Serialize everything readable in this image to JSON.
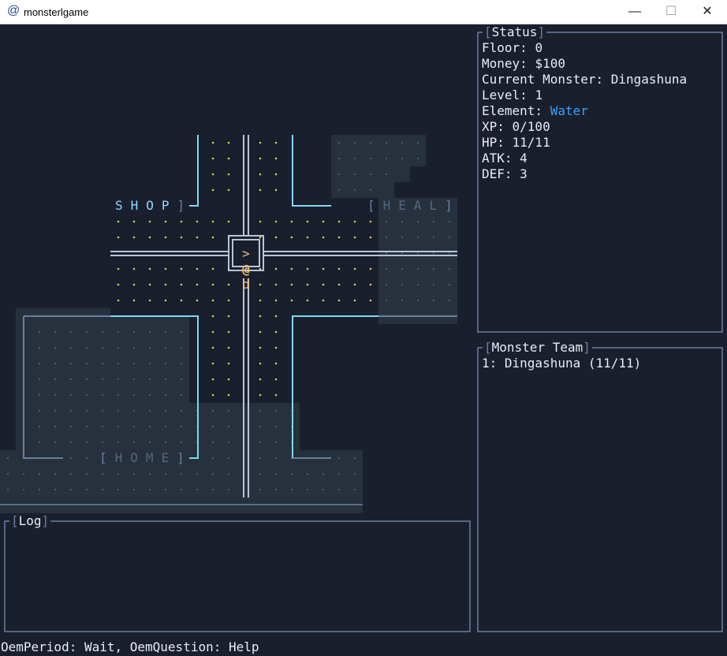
{
  "window": {
    "title": "monsterlgame",
    "app_icon": "@",
    "minimize": "—",
    "maximize": "☐",
    "close": "✕"
  },
  "map": {
    "shop_label": "SHOP",
    "heal_label": "HEAL",
    "home_label": "HOME",
    "stairs_glyph": ">",
    "player_glyph": "@",
    "companion_glyph": "d"
  },
  "status": {
    "title": "Status",
    "floor_label": "Floor: ",
    "floor": "0",
    "money_label": "Money: ",
    "money": "$100",
    "monster_label": "Current Monster: ",
    "monster": "Dingashuna",
    "level_label": "Level: ",
    "level": "1",
    "element_label": "Element: ",
    "element": "Water",
    "xp_label": "XP: ",
    "xp": "0/100",
    "hp_label": "HP: ",
    "hp": "11/11",
    "atk_label": "ATK: ",
    "atk": "4",
    "def_label": "DEF: ",
    "def": "3"
  },
  "team": {
    "title": "Monster Team",
    "members": [
      "1: Dingashuna (11/11)"
    ]
  },
  "log": {
    "title": "Log"
  },
  "hint": "OemPeriod: Wait, OemQuestion: Help",
  "colors": {
    "background": "#1a1f2e",
    "border": "#6b7fa0",
    "text": "#e8ecf5",
    "element_water": "#3ea0ff",
    "room_wall": "#7fd8f0",
    "floor_dot": "#c8d44a",
    "explored_fill": "#2a3540",
    "player": "#f0c070"
  }
}
